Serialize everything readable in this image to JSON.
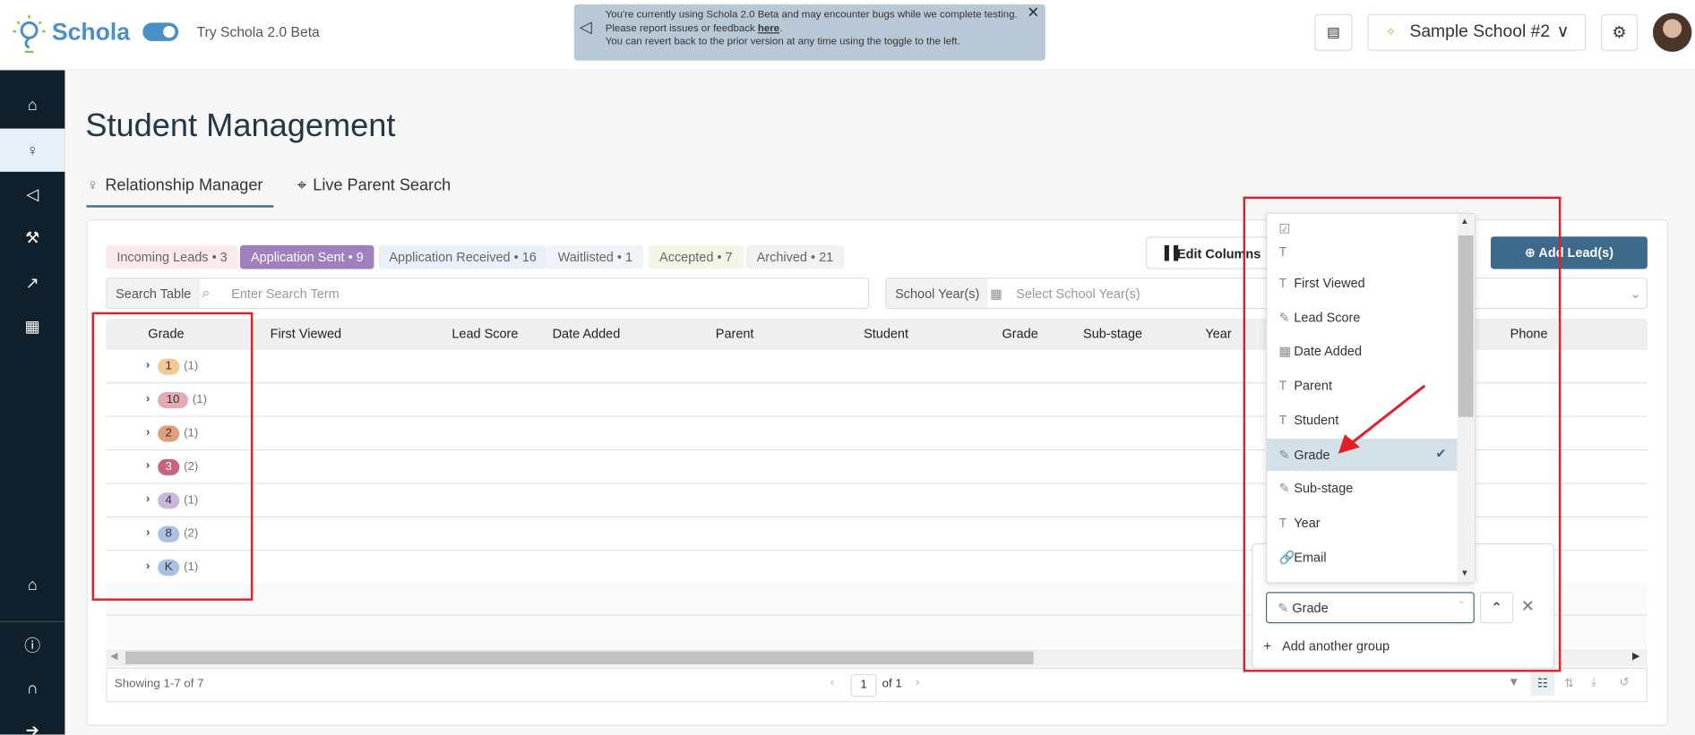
{
  "header": {
    "brand": "Schola",
    "beta_label": "Try Schola 2.0 Beta",
    "banner": {
      "line1": "You're currently using Schola 2.0 Beta and may encounter bugs while we complete testing.",
      "line2_prefix": "Please report issues or feedback ",
      "line2_link": "here",
      "line2_suffix": ".",
      "line3": "You can revert back to the prior version at any time using the toggle to the left."
    },
    "school": "Sample School #2"
  },
  "sidebar": {
    "items": [
      "home-icon",
      "relationship-icon",
      "megaphone-icon",
      "wrench-icon",
      "chart-icon",
      "calendar-icon",
      "school-icon",
      "info-icon",
      "headset-icon",
      "logout-icon"
    ],
    "active": "relationship-icon"
  },
  "page": {
    "title": "Student Management",
    "tabs": [
      {
        "label": "Relationship Manager",
        "active": true
      },
      {
        "label": "Live Parent Search"
      }
    ]
  },
  "stages": [
    {
      "label": "Incoming Leads • 3",
      "bg": "#fbe9ec"
    },
    {
      "label": "Application Sent • 9",
      "bg": "#a07fbd"
    },
    {
      "label": "Application Received • 16",
      "bg": "#e9f0f7"
    },
    {
      "label": "Waitlisted • 1",
      "bg": "#eef4f9"
    },
    {
      "label": "Accepted • 7",
      "bg": "#f1f6e6"
    },
    {
      "label": "Archived • 21",
      "bg": "#f2f2f3"
    }
  ],
  "toolbar": {
    "edit_columns": "Edit Columns",
    "add_leads": "Add Lead(s)",
    "search_label": "Search Table",
    "search_placeholder": "Enter Search Term",
    "year_label": "School Year(s)",
    "year_placeholder": "Select School Year(s)"
  },
  "table": {
    "columns": [
      "Grade",
      "First Viewed",
      "Lead Score",
      "Date Added",
      "Parent",
      "Student",
      "Grade",
      "Sub-stage",
      "Year",
      "Phone"
    ],
    "groups": [
      {
        "grade": "1",
        "count": "(1)",
        "color": "#f2c994"
      },
      {
        "grade": "10",
        "count": "(1)",
        "color": "#e3a9b5"
      },
      {
        "grade": "2",
        "count": "(1)",
        "color": "#e0a07c"
      },
      {
        "grade": "3",
        "count": "(2)",
        "color": "#c9637a"
      },
      {
        "grade": "4",
        "count": "(1)",
        "color": "#c9b6dc"
      },
      {
        "grade": "8",
        "count": "(2)",
        "color": "#a9c1e3"
      },
      {
        "grade": "K",
        "count": "(1)",
        "color": "#a9c1e3"
      }
    ]
  },
  "footer": {
    "showing": "Showing 1-7 of 7",
    "page": "1",
    "of": "of 1"
  },
  "dropdown": {
    "items": [
      {
        "icon": "checkbox-icon",
        "label": ""
      },
      {
        "icon": "text-icon",
        "label": ""
      },
      {
        "icon": "text-icon",
        "label": "First Viewed"
      },
      {
        "icon": "tag-icon",
        "label": "Lead Score"
      },
      {
        "icon": "calendar-icon",
        "label": "Date Added"
      },
      {
        "icon": "text-icon",
        "label": "Parent"
      },
      {
        "icon": "text-icon",
        "label": "Student"
      },
      {
        "icon": "tag-icon",
        "label": "Grade",
        "selected": true
      },
      {
        "icon": "tag-icon",
        "label": "Sub-stage"
      },
      {
        "icon": "text-icon",
        "label": "Year"
      },
      {
        "icon": "link-icon",
        "label": "Email"
      }
    ]
  },
  "group_panel": {
    "selected": "Grade",
    "add_group": "Add another group"
  }
}
